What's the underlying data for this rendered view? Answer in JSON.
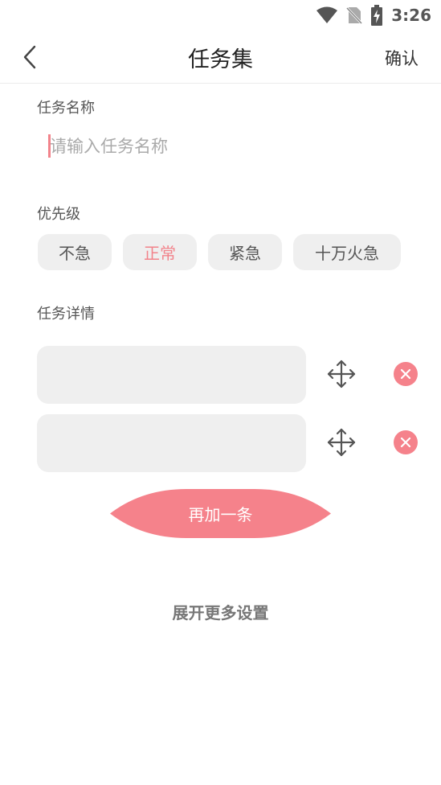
{
  "status_bar": {
    "time": "3:26",
    "icons": [
      "wifi-icon",
      "no-sim-icon",
      "battery-charging-icon"
    ]
  },
  "header": {
    "title": "任务集",
    "confirm_label": "确认",
    "back_icon": "chevron-left-icon"
  },
  "task_name": {
    "label": "任务名称",
    "placeholder": "请输入任务名称",
    "value": ""
  },
  "priority": {
    "label": "优先级",
    "options": [
      {
        "label": "不急",
        "selected": false
      },
      {
        "label": "正常",
        "selected": true
      },
      {
        "label": "紧急",
        "selected": false
      },
      {
        "label": "十万火急",
        "selected": false
      }
    ]
  },
  "details": {
    "label": "任务详情",
    "items": [
      {
        "value": "",
        "move_icon": "move-icon",
        "remove_icon": "close-circle-icon"
      },
      {
        "value": "",
        "move_icon": "move-icon",
        "remove_icon": "close-circle-icon"
      }
    ],
    "add_label": "再加一条"
  },
  "more_settings_label": "展开更多设置",
  "colors": {
    "accent": "#f5828b",
    "chip_bg": "#efefef",
    "text": "#333333"
  }
}
